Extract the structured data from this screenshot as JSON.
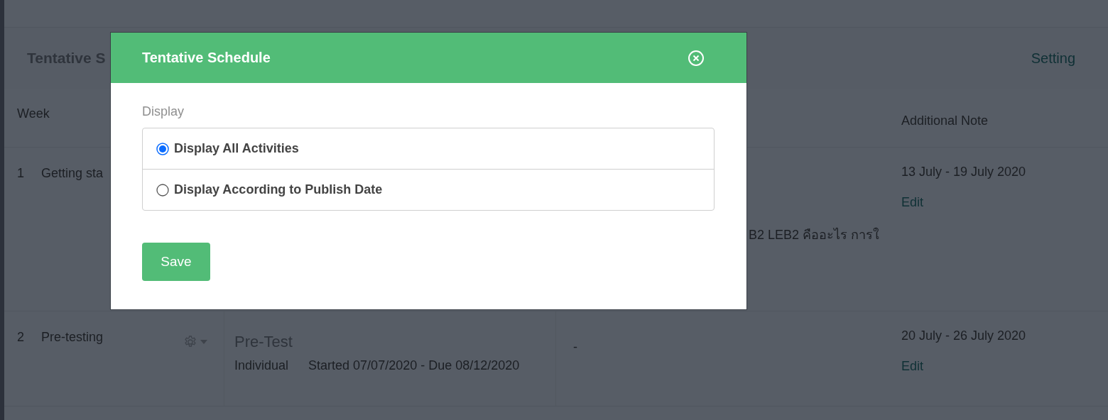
{
  "page": {
    "title": "Tentative S",
    "setting_link": "Setting"
  },
  "table": {
    "columns": [
      "Week",
      "Additional Note"
    ],
    "rows": [
      {
        "number": "1",
        "week_title": "Getting sta",
        "column_3": "B2 LEB2 คืออะไร การใ",
        "period": "13 July - 19 July 2020",
        "edit": "Edit"
      },
      {
        "number": "2",
        "week_title": "Pre-testing",
        "activity": {
          "title": "Pre-Test",
          "mode": "Individual",
          "dates": "Started 07/07/2020 - Due 08/12/2020"
        },
        "column_3": "-",
        "period": "20 July - 26 July 2020",
        "edit": "Edit"
      }
    ]
  },
  "modal": {
    "title": "Tentative Schedule",
    "field_label": "Display",
    "options": [
      {
        "label": "Display All Activities",
        "selected": true
      },
      {
        "label": "Display According to Publish Date",
        "selected": false
      }
    ],
    "save": "Save"
  }
}
